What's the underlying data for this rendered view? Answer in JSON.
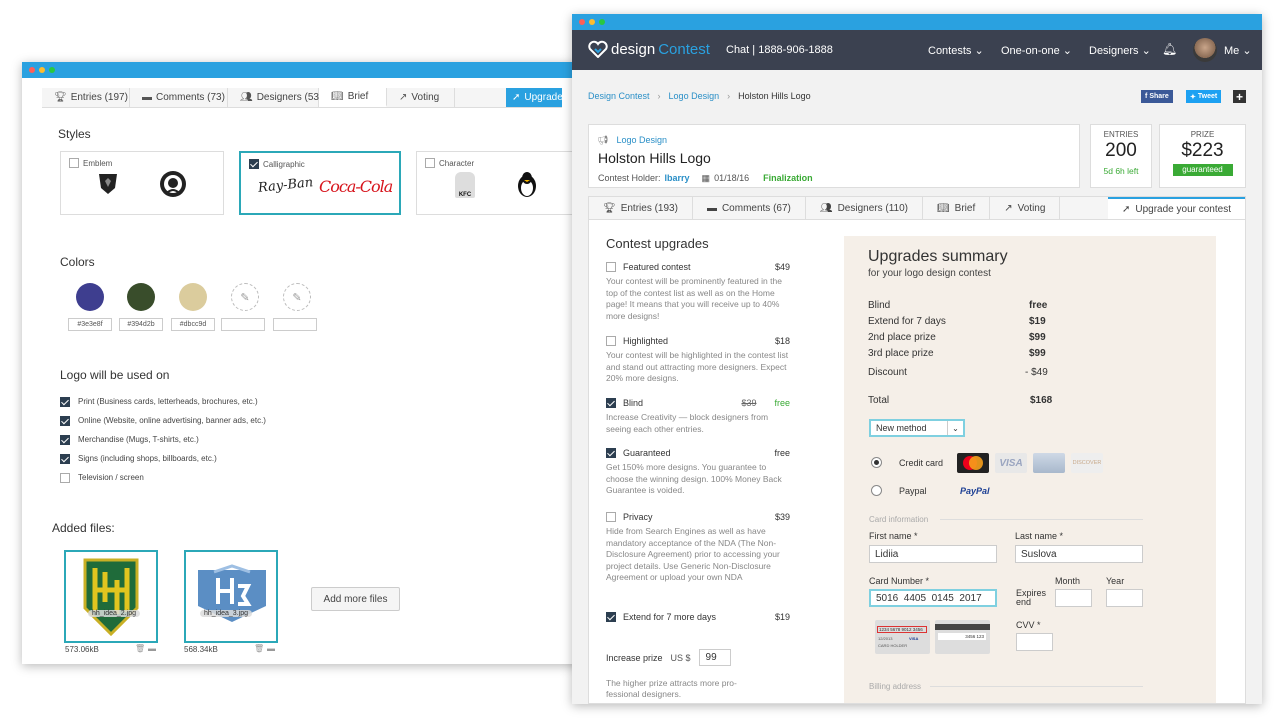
{
  "back_window": {
    "tabs": [
      {
        "icon": "trophy-icon",
        "label": "Entries (197)"
      },
      {
        "icon": "comments-icon",
        "label": "Comments (73)"
      },
      {
        "icon": "users-icon",
        "label": "Designers (53)"
      },
      {
        "icon": "book-icon",
        "label": "Brief"
      },
      {
        "icon": "chart-icon",
        "label": "Voting"
      }
    ],
    "upgrade_tab": "Upgrade yo",
    "styles_title": "Styles",
    "styles": [
      {
        "label": "Emblem",
        "checked": false
      },
      {
        "label": "Calligraphic",
        "checked": true
      },
      {
        "label": "Character",
        "checked": false
      }
    ],
    "style_logos": {
      "rayban": "Ray-Ban",
      "cocacola": "Coca-Cola",
      "kfc": "KFC"
    },
    "colors_title": "Colors",
    "colors": [
      {
        "hex": "#3e3e8f",
        "label": "#3e3e8f"
      },
      {
        "hex": "#394d2b",
        "label": "#394d2b"
      },
      {
        "hex": "#dbcc9d",
        "label": "#dbcc9d"
      },
      {
        "hex": "",
        "label": ""
      },
      {
        "hex": "",
        "label": ""
      }
    ],
    "usage_title": "Logo will be used on",
    "usage": [
      {
        "label": "Print (Business cards, letterheads, brochures, etc.)",
        "checked": true
      },
      {
        "label": "Online (Website, online advertising, banner ads, etc.)",
        "checked": true
      },
      {
        "label": "Merchandise (Mugs, T-shirts, etc.)",
        "checked": true
      },
      {
        "label": "Signs (including shops, billboards, etc.)",
        "checked": true
      },
      {
        "label": "Television / screen",
        "checked": false
      }
    ],
    "files_title": "Added files:",
    "files": [
      {
        "name": "hh_idea_2.jpg",
        "size": "573.06kB"
      },
      {
        "name": "hh_idea_3.jpg",
        "size": "568.34kB"
      }
    ],
    "add_files_button": "Add more files"
  },
  "front_window": {
    "nav": {
      "logo_a": "design",
      "logo_b": "Contest",
      "chat": "Chat | 1888-906-1888",
      "items": [
        "Contests",
        "One-on-one",
        "Designers"
      ],
      "user": "Me"
    },
    "breadcrumb": [
      "Design Contest",
      "Logo Design",
      "Holston Hills Logo"
    ],
    "share": {
      "facebook": "Share",
      "twitter": "Tweet"
    },
    "contest": {
      "category": "Logo Design",
      "title": "Holston Hills Logo",
      "holder_label": "Contest Holder:",
      "holder": "lbarry",
      "date": "01/18/16",
      "stage": "Finalization"
    },
    "entries": {
      "label": "ENTRIES",
      "value": "200",
      "time_left": "5d 6h left"
    },
    "prize": {
      "label": "PRIZE",
      "value": "$223",
      "badge": "guaranteed"
    },
    "tabs": [
      {
        "icon": "trophy-icon",
        "label": "Entries (193)"
      },
      {
        "icon": "comments-icon",
        "label": "Comments (67)"
      },
      {
        "icon": "users-icon",
        "label": "Designers (110)"
      },
      {
        "icon": "book-icon",
        "label": "Brief"
      },
      {
        "icon": "chart-icon",
        "label": "Voting"
      },
      {
        "icon": "rocket-icon",
        "label": "Upgrade your contest"
      }
    ],
    "upgrades_title": "Contest upgrades",
    "upgrades": [
      {
        "name": "Featured contest",
        "price": "$49",
        "checked": false,
        "desc": "Your contest will be prominently featured in the top of the contest list as well as on the Home page! It means that you will receive up to 40% more designs!"
      },
      {
        "name": "Highlighted",
        "price": "$18",
        "checked": false,
        "desc": "Your contest will be highlighted in the contest list and stand out attracting more designers. Expect 20% more designs."
      },
      {
        "name": "Blind",
        "old_price": "$39",
        "price": "free",
        "checked": true,
        "desc": "Increase Creativity — block designers from seeing each other entries."
      },
      {
        "name": "Guaranteed",
        "price": "free",
        "checked": true,
        "desc": "Get 150% more designs. You guarantee to choose the winning design. 100% Money Back Guarantee is voided."
      },
      {
        "name": "Privacy",
        "price": "$39",
        "checked": false,
        "desc": "Hide from Search Engines as well as have mandatory acceptance of the NDA (The Non-Disclosure Agreement) prior to accessing your project details. Use Generic Non-Disclosure Agreement or upload your own NDA"
      },
      {
        "name": "Extend for 7 more days",
        "price": "$19",
        "checked": true,
        "desc": ""
      }
    ],
    "increase_prize": {
      "label": "Increase prize",
      "currency": "US $",
      "value": "99",
      "note": "The higher prize attracts more pro-fessional designers."
    },
    "summary": {
      "title": "Upgrades summary",
      "subtitle": "for your logo design contest",
      "rows": [
        {
          "label": "Blind",
          "value": "free"
        },
        {
          "label": "Extend for 7 days",
          "value": "$19"
        },
        {
          "label": "2nd place prize",
          "value": "$99"
        },
        {
          "label": "3rd place prize",
          "value": "$99"
        }
      ],
      "discount": {
        "label": "Discount",
        "value": "- $49"
      },
      "total": {
        "label": "Total",
        "value": "$168"
      },
      "method_select": "New method",
      "credit_card_label": "Credit card",
      "paypal_label": "Paypal",
      "paypal_logo": "PayPal",
      "card_brands": {
        "visa": "VISA",
        "discover": "DISCOVER"
      },
      "card_info_label": "Card information",
      "first_name_label": "First name *",
      "first_name": "Lidiia",
      "last_name_label": "Last name *",
      "last_name": "Suslova",
      "card_number_label": "Card Number *",
      "card_number": "5016  4405  0145  2017",
      "expires_label": "Expires end",
      "month_label": "Month",
      "year_label": "Year",
      "cvv_label": "CVV *",
      "card_front_number": "1234 5678 9012 3456",
      "card_front_date": "12/2013",
      "card_holder": "CARD HOLDER",
      "card_back_number": "3456 123",
      "billing_label": "Billing address"
    }
  }
}
